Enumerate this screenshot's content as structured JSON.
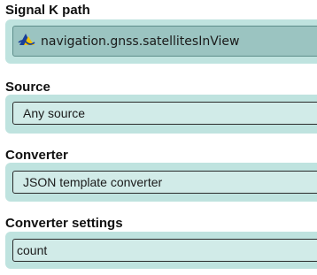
{
  "signalk": {
    "label": "Signal K path",
    "value": "navigation.gnss.satellitesInView",
    "icon": "signalk-icon"
  },
  "source": {
    "label": "Source",
    "value": "Any source"
  },
  "converter": {
    "label": "Converter",
    "value": "JSON template converter"
  },
  "converter_settings": {
    "label": "Converter settings",
    "value": "count"
  }
}
